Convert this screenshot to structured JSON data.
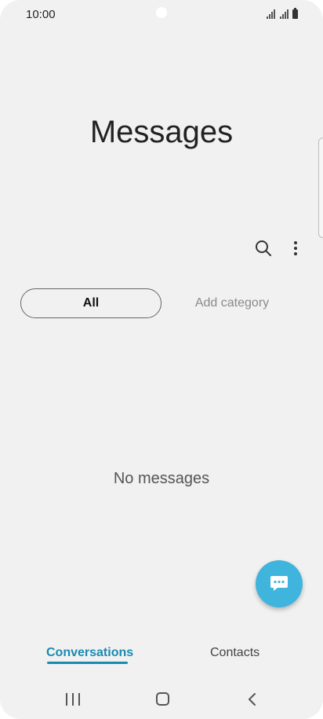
{
  "status_bar": {
    "time": "10:00"
  },
  "header": {
    "title": "Messages"
  },
  "toolbar": {
    "search_icon": "search-icon",
    "more_icon": "more-vertical-icon"
  },
  "categories": {
    "items": [
      {
        "label": "All",
        "selected": true
      },
      {
        "label": "Add category",
        "selected": false
      }
    ]
  },
  "main": {
    "empty_text": "No messages"
  },
  "fab": {
    "icon": "compose-message-icon"
  },
  "bottom_tabs": [
    {
      "label": "Conversations",
      "active": true
    },
    {
      "label": "Contacts",
      "active": false
    }
  ],
  "nav_bar": {
    "recent_icon": "recent-apps-icon",
    "home_icon": "home-icon",
    "back_icon": "back-icon"
  },
  "colors": {
    "background": "#f1f1f1",
    "accent": "#1a8ab3",
    "fab": "#3fb4dd"
  }
}
